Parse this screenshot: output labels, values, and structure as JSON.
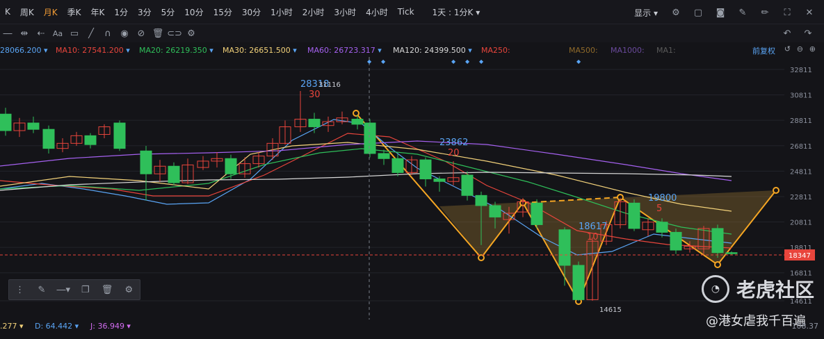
{
  "topbar": {
    "periods": [
      "K",
      "周K",
      "月K",
      "季K",
      "年K",
      "1分",
      "3分",
      "5分",
      "10分",
      "15分",
      "30分",
      "1小时",
      "2小时",
      "3小时",
      "4小时",
      "Tick"
    ],
    "active_period": "月K",
    "interval_selector": "1天 : 1分K",
    "display_label": "显示"
  },
  "ma_legend": [
    {
      "label": "",
      "value": "28066.200",
      "color": "#5aa5f5"
    },
    {
      "label": "MA10:",
      "value": "27541.200",
      "color": "#e8453c"
    },
    {
      "label": "MA20:",
      "value": "26219.350",
      "color": "#2fbf5a"
    },
    {
      "label": "MA30:",
      "value": "26651.500",
      "color": "#f3d27a"
    },
    {
      "label": "MA60:",
      "value": "26723.317",
      "color": "#a561f0"
    },
    {
      "label": "MA120:",
      "value": "24399.500",
      "color": "#d8d8d8"
    },
    {
      "label": "MA250:",
      "value": "",
      "color": "#e8453c"
    },
    {
      "label": "MA500:",
      "value": "",
      "color": "#8f6a2a"
    },
    {
      "label": "MA1000:",
      "value": "",
      "color": "#6a4a9c"
    },
    {
      "label": "MA1:",
      "value": "",
      "color": "#5a5a5a"
    }
  ],
  "adjust_label": "前复权",
  "price_axis": [
    "32811",
    "30811",
    "28811",
    "26811",
    "24811",
    "22811",
    "20811",
    "18811",
    "16811",
    "14611"
  ],
  "current_price": "18347",
  "annotations": [
    {
      "value": "28318",
      "count": "30"
    },
    {
      "value": "23862",
      "count": "20"
    },
    {
      "value": "18617",
      "count": "10"
    },
    {
      "value": "19800",
      "count": "5"
    }
  ],
  "high_label": "31116",
  "low_label": "14615",
  "indicators": [
    {
      "label": "",
      "value": ".277",
      "color": "#f3d27a"
    },
    {
      "label": "D:",
      "value": "64.442",
      "color": "#5aa5f5"
    },
    {
      "label": "J:",
      "value": "36.949",
      "color": "#d26cf0"
    }
  ],
  "bottom_axis_value": "108.37",
  "watermark": "老虎社区",
  "author": "@港女虐我千百遍",
  "colors": {
    "up": "#e8453c",
    "down": "#2fbf5a",
    "pattern": "#f5a623",
    "background": "#141418"
  }
}
